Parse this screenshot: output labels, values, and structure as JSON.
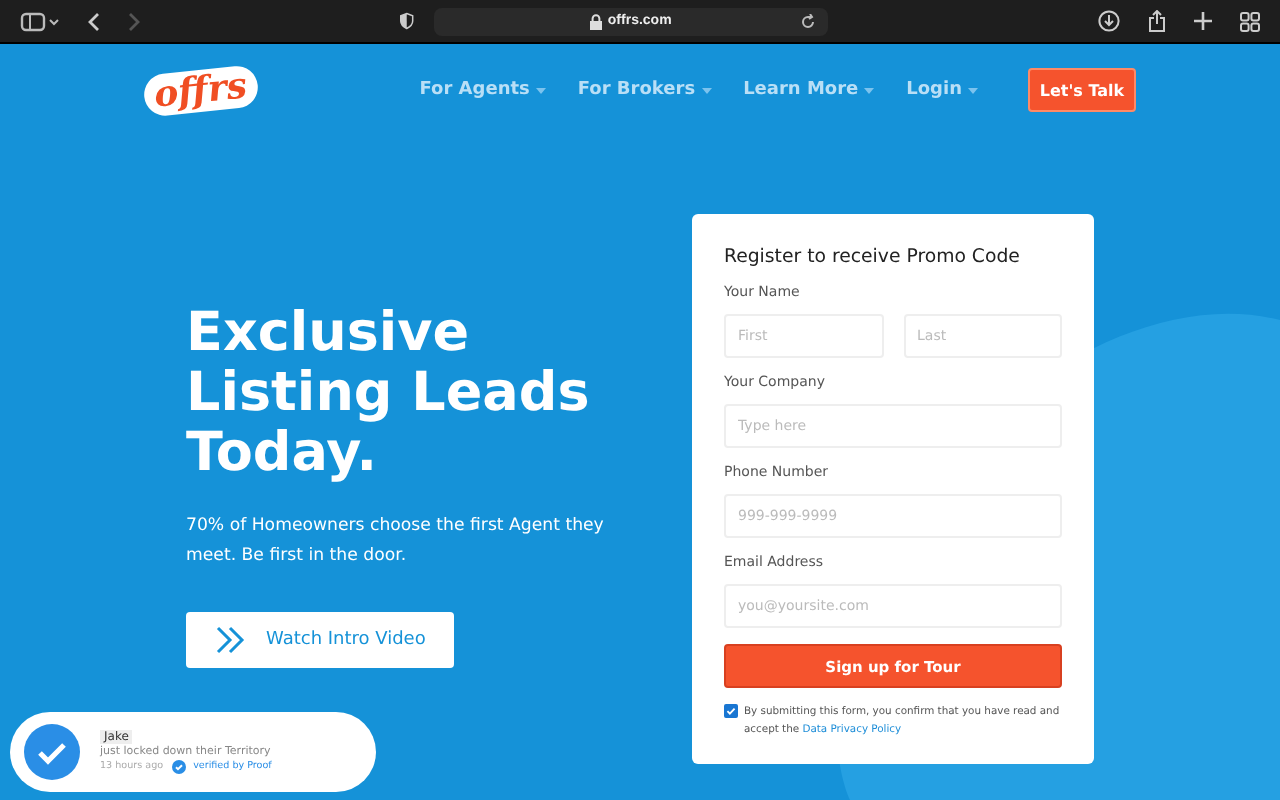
{
  "browser": {
    "url": "offrs.com"
  },
  "nav": {
    "logo": "offrs",
    "items": [
      {
        "label": "For Agents",
        "dropdown": true
      },
      {
        "label": "For Brokers",
        "dropdown": true
      },
      {
        "label": "Learn More",
        "dropdown": true
      },
      {
        "label": "Login",
        "dropdown": true
      }
    ],
    "cta": "Let's Talk"
  },
  "hero": {
    "title": "Exclusive Listing Leads Today.",
    "subtitle": "70% of Homeowners choose the first Agent they meet. Be first in the door.",
    "video_button": "Watch Intro Video"
  },
  "form": {
    "title": "Register to receive Promo Code",
    "fields": [
      {
        "label": "Your Name",
        "inputs": [
          {
            "placeholder": "First"
          },
          {
            "placeholder": "Last"
          }
        ]
      },
      {
        "label": "Your Company",
        "inputs": [
          {
            "placeholder": "Type here"
          }
        ]
      },
      {
        "label": "Phone Number",
        "inputs": [
          {
            "placeholder": "999-999-9999"
          }
        ]
      },
      {
        "label": "Email Address",
        "inputs": [
          {
            "placeholder": "you@yoursite.com"
          }
        ]
      }
    ],
    "submit": "Sign up for Tour",
    "consent": {
      "checked": true,
      "text": "By submitting this form, you confirm that you have read and accept the",
      "link": "Data Privacy Policy"
    }
  },
  "notification": {
    "name": "Jake",
    "message": "just locked down their Territory",
    "time": "13 hours ago",
    "verified": "verified by Proof"
  }
}
